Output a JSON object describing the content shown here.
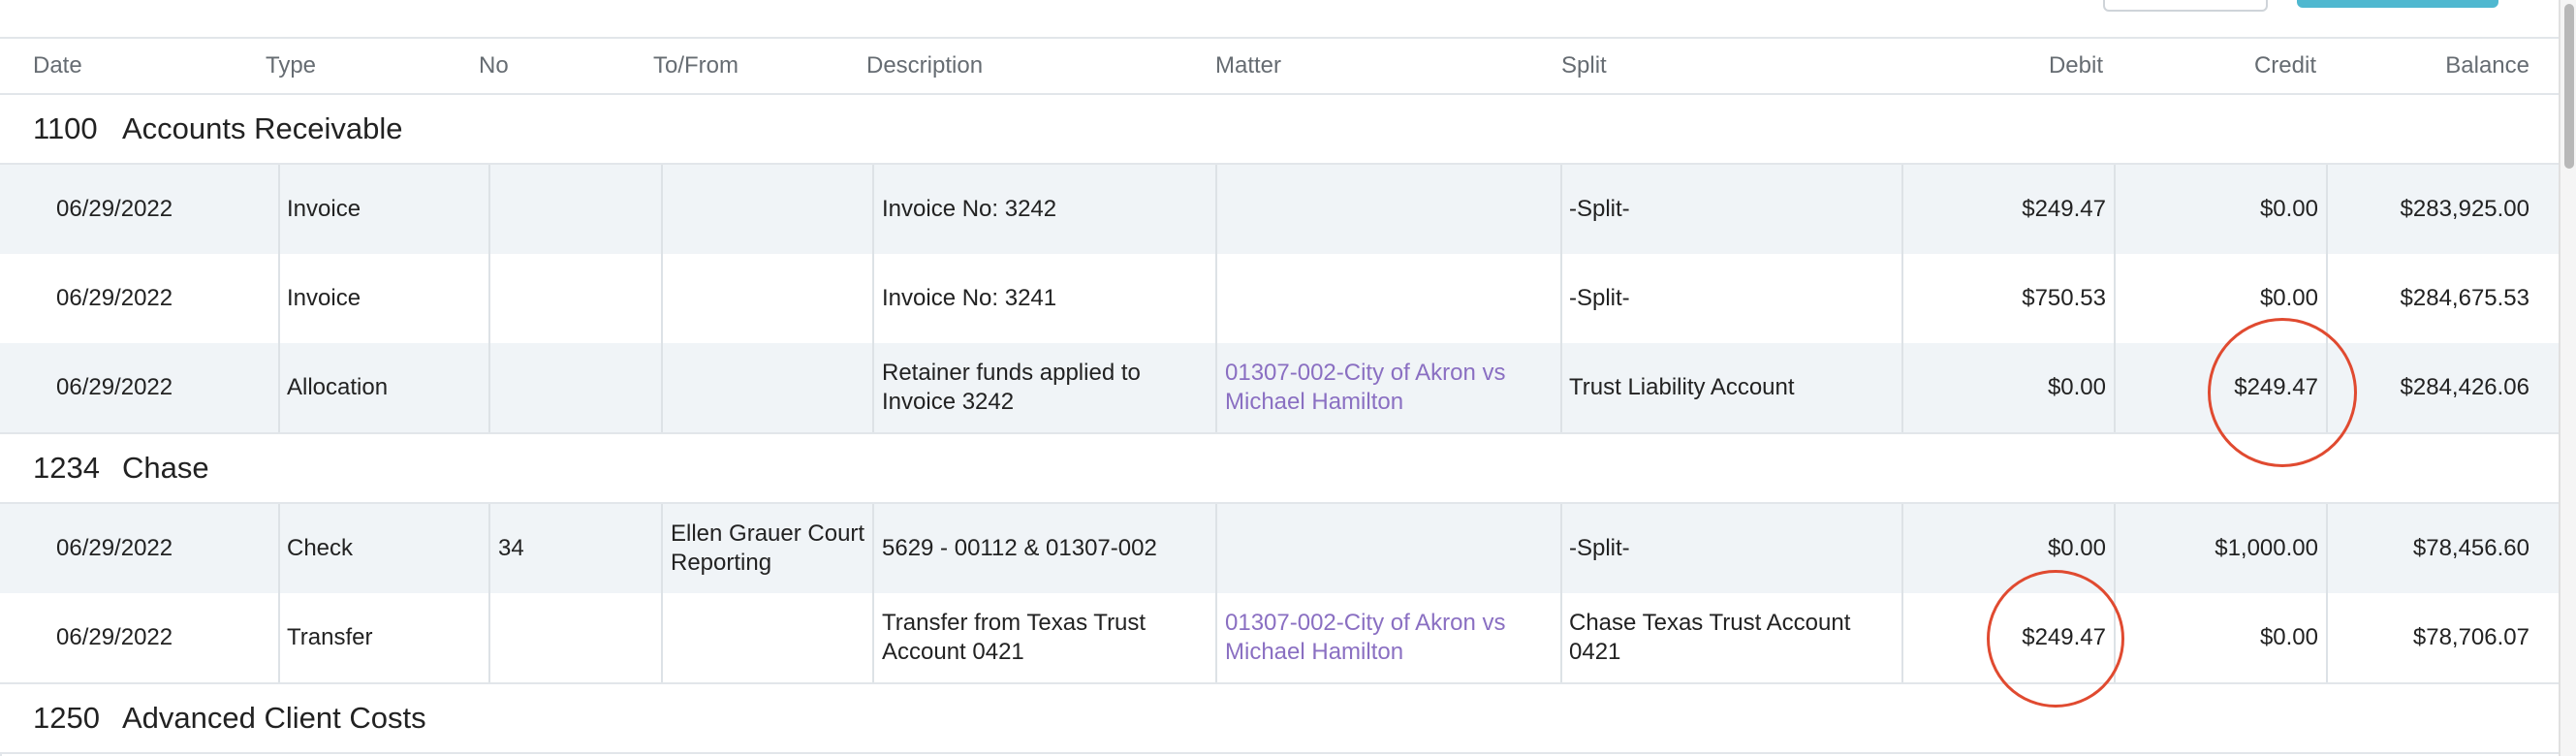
{
  "columns": {
    "date": "Date",
    "type": "Type",
    "no": "No",
    "to_from": "To/From",
    "description": "Description",
    "matter": "Matter",
    "split": "Split",
    "debit": "Debit",
    "credit": "Credit",
    "balance": "Balance"
  },
  "sections": [
    {
      "number": "1100",
      "name": "Accounts Receivable",
      "rows": [
        {
          "date": "06/29/2022",
          "type": "Invoice",
          "no": "",
          "to_from": "",
          "description": "Invoice No: 3242",
          "matter": "",
          "split": "-Split-",
          "debit": "$249.47",
          "credit": "$0.00",
          "balance": "$283,925.00"
        },
        {
          "date": "06/29/2022",
          "type": "Invoice",
          "no": "",
          "to_from": "",
          "description": "Invoice No: 3241",
          "matter": "",
          "split": "-Split-",
          "debit": "$750.53",
          "credit": "$0.00",
          "balance": "$284,675.53"
        },
        {
          "date": "06/29/2022",
          "type": "Allocation",
          "no": "",
          "to_from": "",
          "description": "Retainer funds applied to Invoice 3242",
          "matter": "01307-002-City of Akron vs Michael Hamilton",
          "split": "Trust Liability Account",
          "debit": "$0.00",
          "credit": "$249.47",
          "balance": "$284,426.06"
        }
      ]
    },
    {
      "number": "1234",
      "name": "Chase",
      "rows": [
        {
          "date": "06/29/2022",
          "type": "Check",
          "no": "34",
          "to_from": "Ellen Grauer Court Reporting",
          "description": "5629 - 00112 & 01307-002",
          "matter": "",
          "split": "-Split-",
          "debit": "$0.00",
          "credit": "$1,000.00",
          "balance": "$78,456.60"
        },
        {
          "date": "06/29/2022",
          "type": "Transfer",
          "no": "",
          "to_from": "",
          "description": "Transfer from Texas Trust Account 0421",
          "matter": "01307-002-City of Akron vs Michael Hamilton",
          "split": "Chase Texas Trust Account 0421",
          "debit": "$249.47",
          "credit": "$0.00",
          "balance": "$78,706.07"
        }
      ]
    },
    {
      "number": "1250",
      "name": "Advanced Client Costs",
      "rows": []
    }
  ],
  "colors": {
    "link": "#8a6fc2",
    "annotation": "#e04a30",
    "shaded_row": "#f0f4f7",
    "primary_button": "#4fb8d0"
  }
}
